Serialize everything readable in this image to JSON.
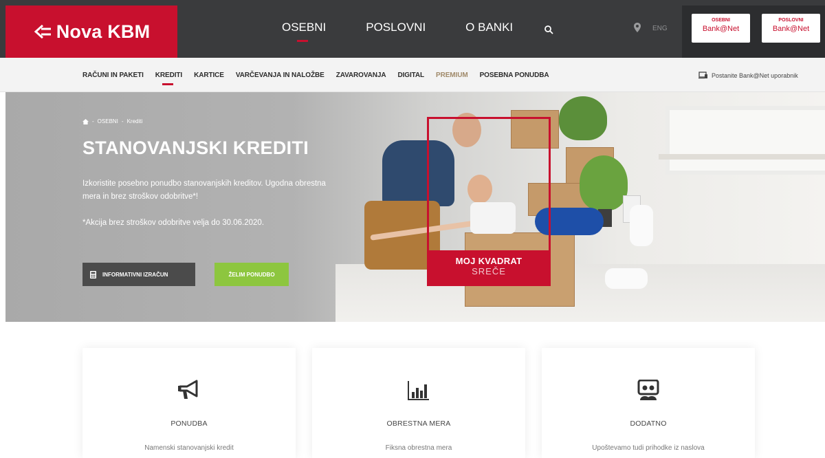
{
  "brand": {
    "name": "Nova KBM",
    "primary_color": "#c8102e",
    "dark_color": "#3a3b3d",
    "accent_green": "#8dc63f"
  },
  "header": {
    "nav": [
      {
        "label": "OSEBNI",
        "active": true
      },
      {
        "label": "POSLOVNI",
        "active": false
      },
      {
        "label": "O BANKI",
        "active": false
      }
    ],
    "search_icon": "search-icon",
    "location_icon": "map-pin-icon",
    "language": "ENG",
    "banknet": [
      {
        "top": "OSEBNI",
        "bottom": "Bank@Net"
      },
      {
        "top": "POSLOVNI",
        "bottom": "Bank@Net"
      }
    ]
  },
  "subnav": {
    "items": [
      {
        "label": "RAČUNI IN PAKETI"
      },
      {
        "label": "KREDITI",
        "active": true
      },
      {
        "label": "KARTICE"
      },
      {
        "label": "VARČEVANJA IN NALOŽBE"
      },
      {
        "label": "ZAVAROVANJA"
      },
      {
        "label": "DIGITAL"
      },
      {
        "label": "PREMIUM"
      },
      {
        "label": "POSEBNA PONUDBA"
      }
    ],
    "become_user": "Postanite Bank@Net uporabnik"
  },
  "hero": {
    "breadcrumb": {
      "level1": "OSEBNI",
      "level2": "Krediti",
      "separator": "-"
    },
    "title": "STANOVANJSKI KREDITI",
    "text": "Izkoristite posebno ponudbo stanovanjskih kreditov. Ugodna obrestna mera in brez stroškov odobritve*!",
    "note": "*Akcija brez stroškov odobritve velja do 30.06.2020.",
    "btn_calc": "INFORMATIVNI IZRAČUN",
    "btn_offer": "ŽELIM PONUDBO",
    "frame_line1": "MOJ KVADRAT",
    "frame_line2": "SREČE"
  },
  "cards": [
    {
      "icon": "megaphone-icon",
      "title": "PONUDBA",
      "desc": "Namenski stanovanjski kredit"
    },
    {
      "icon": "bar-chart-icon",
      "title": "OBRESTNA MERA",
      "desc": "Fiksna obrestna mera"
    },
    {
      "icon": "people-board-icon",
      "title": "DODATNO",
      "desc": "Upoštevamo tudi prihodke iz naslova"
    }
  ]
}
